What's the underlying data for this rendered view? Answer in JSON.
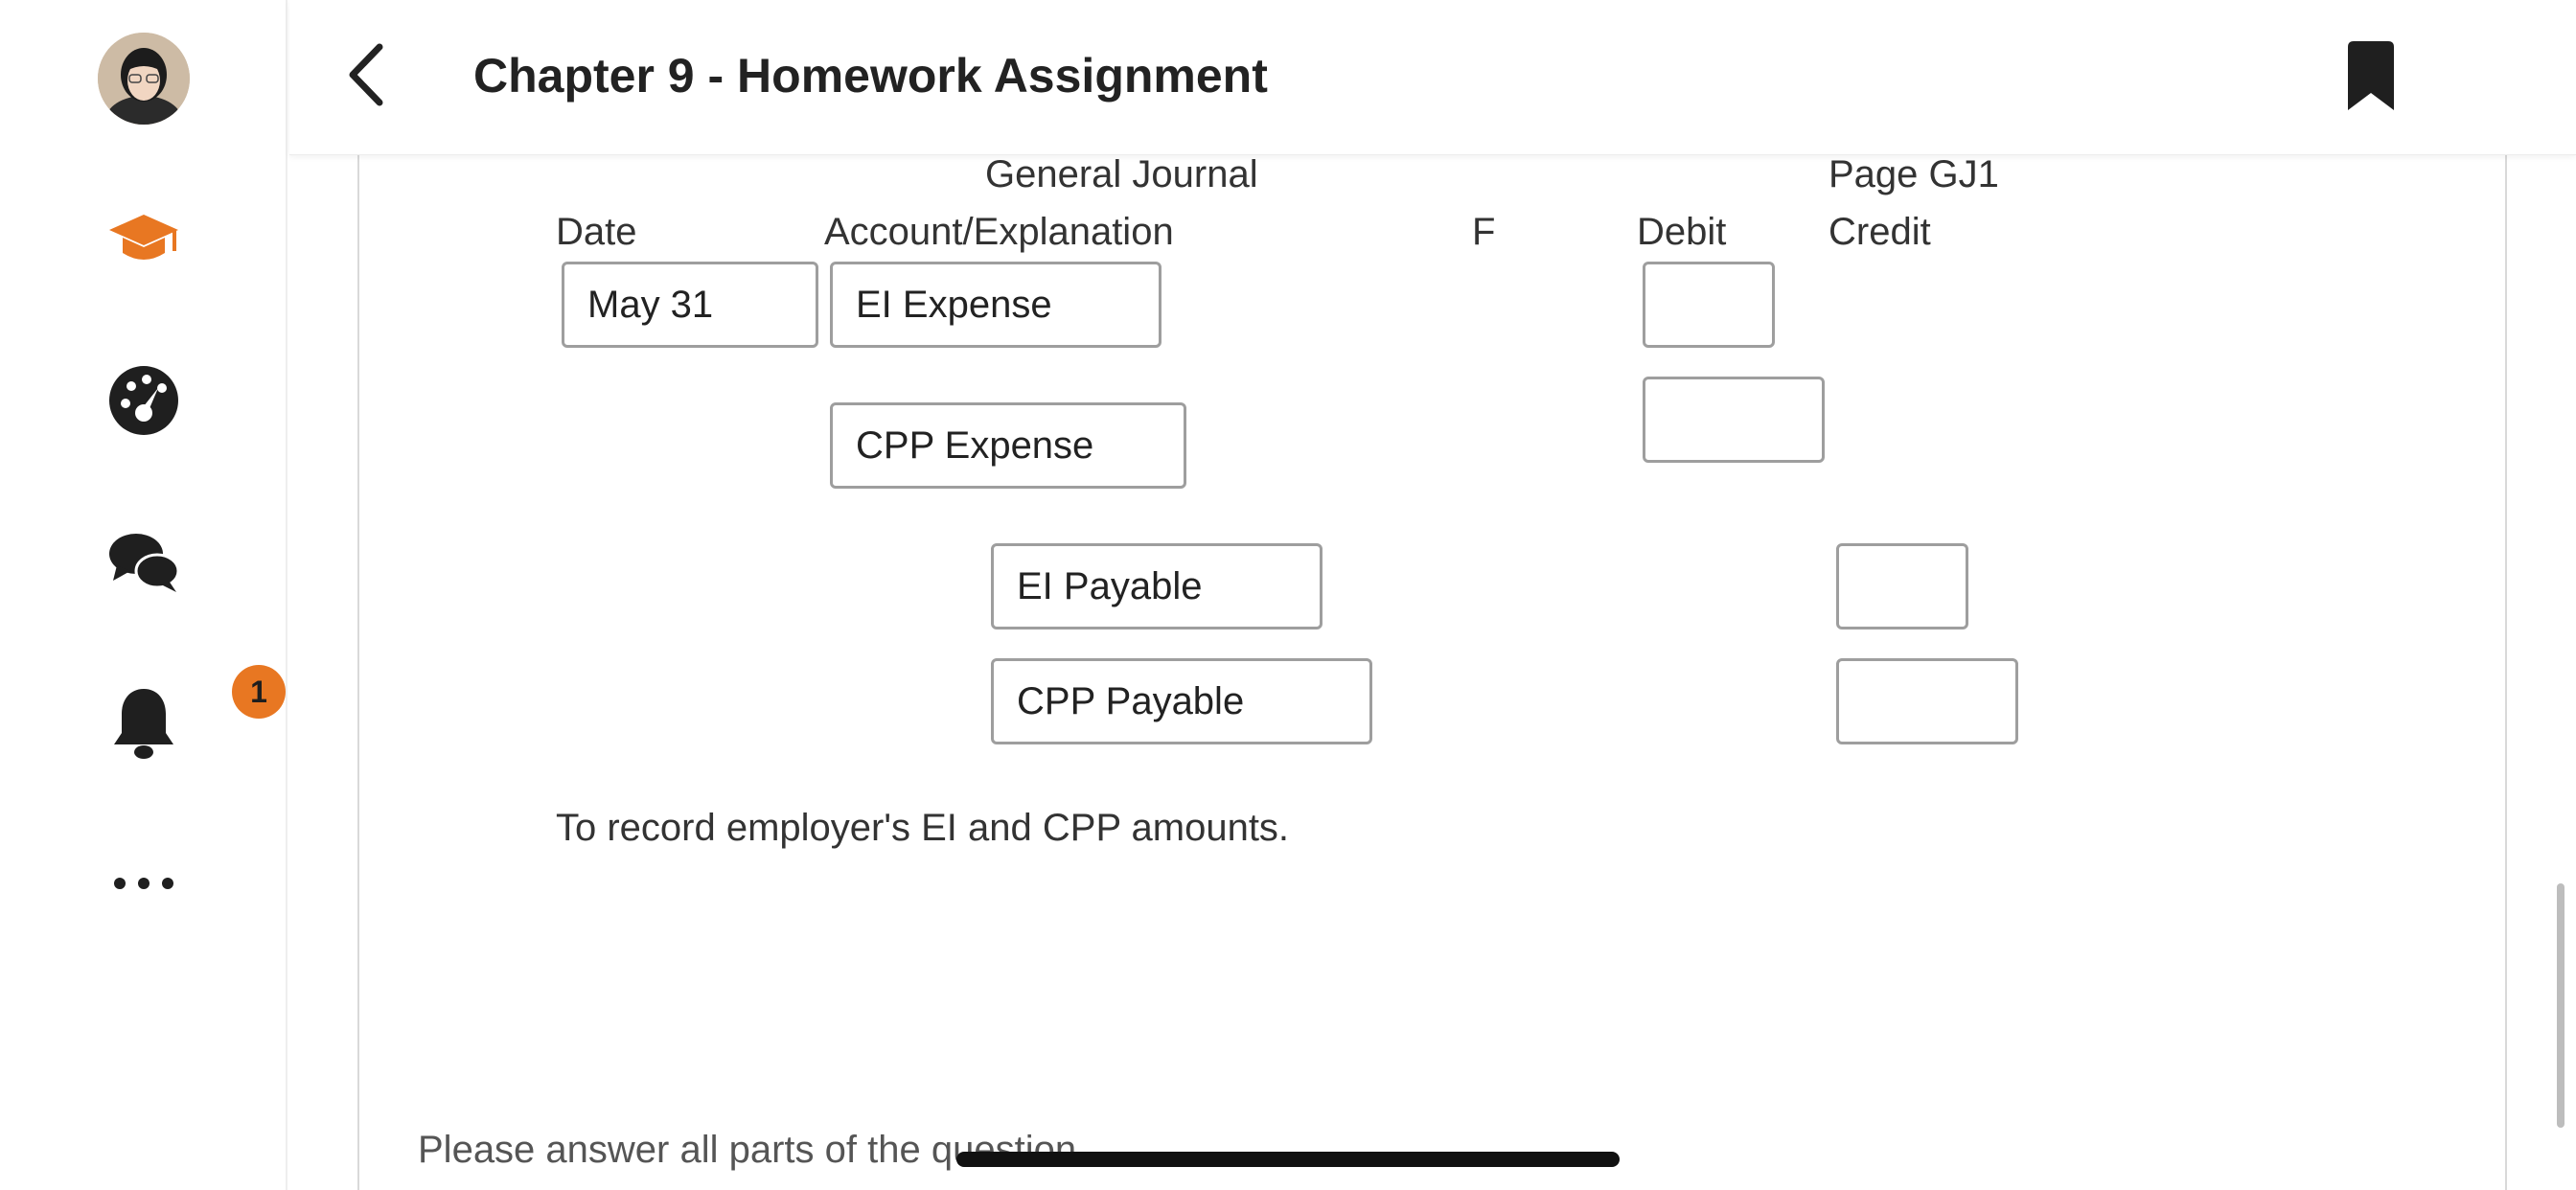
{
  "header": {
    "title": "Chapter 9 - Homework Assignment"
  },
  "sidebar": {
    "notification_count": "1",
    "accent_color": "#e87722"
  },
  "journal": {
    "heading": "General Journal",
    "page_label": "Page GJ1",
    "columns": {
      "date": "Date",
      "account": "Account/Explanation",
      "f": "F",
      "debit": "Debit",
      "credit": "Credit"
    },
    "entry": {
      "date": "May 31",
      "debit_accounts": [
        "EI Expense",
        "CPP Expense"
      ],
      "credit_accounts": [
        "EI Payable",
        "CPP Payable"
      ],
      "debit_amounts": [
        "",
        ""
      ],
      "credit_amounts": [
        "",
        ""
      ]
    },
    "explanation": "To record employer's EI and CPP amounts."
  },
  "footer_text": "Please answer all parts of the question."
}
